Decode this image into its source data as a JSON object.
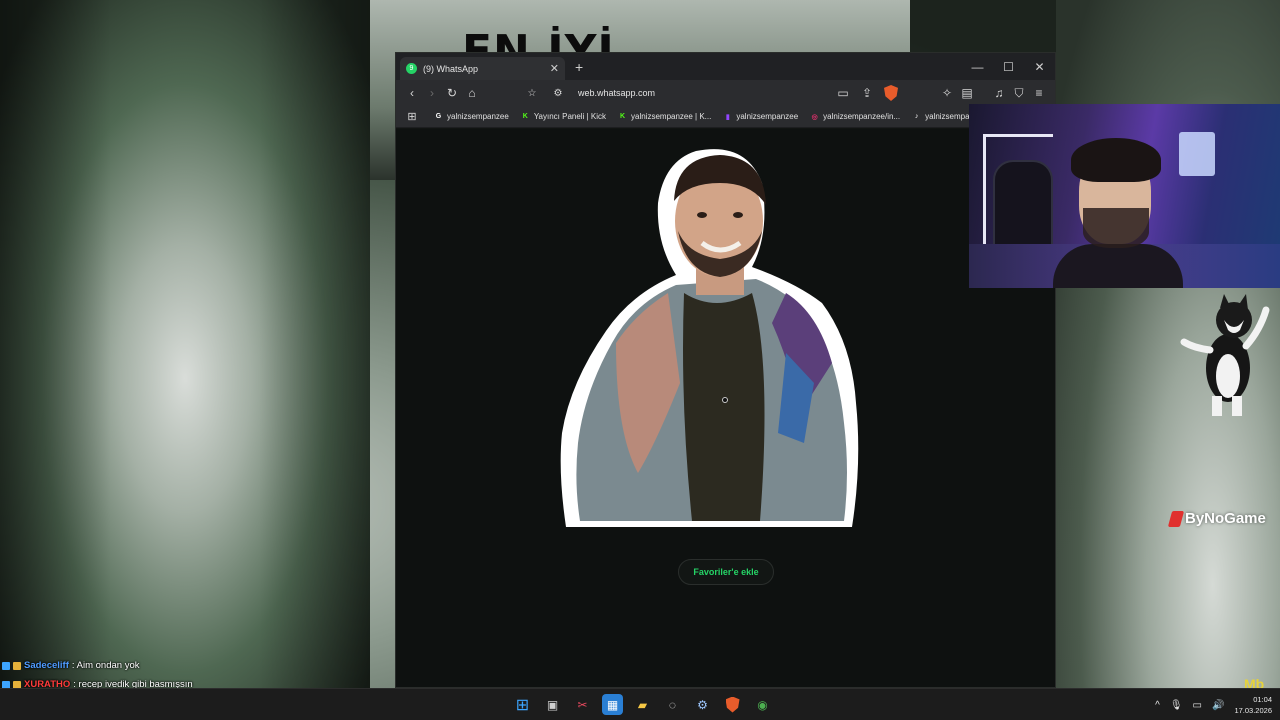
{
  "banner": {
    "text": "EN İYİ AVRUPA"
  },
  "browser": {
    "tab": {
      "favicon_label": "9",
      "title": "(9) WhatsApp",
      "close_icon": "close-icon"
    },
    "new_tab_icon": "plus-icon",
    "window_controls": {
      "minimize": "—",
      "maximize": "☐",
      "close": "✕"
    },
    "toolbar": {
      "back": "‹",
      "forward": "›",
      "reload": "↻",
      "home": "⌂",
      "bookmark": "🔖",
      "url": "web.whatsapp.com"
    },
    "bookmarks": [
      {
        "label": "yalnizsempanzee",
        "icon": "google-icon",
        "color": "#ffffff",
        "glyph": "G"
      },
      {
        "label": "Yayıncı Paneli | Kick",
        "icon": "kick-icon",
        "color": "#53fc18",
        "glyph": "K"
      },
      {
        "label": "yalnizsempanzee | K...",
        "icon": "kick-icon",
        "color": "#53fc18",
        "glyph": "K"
      },
      {
        "label": "yalnizsempanzee",
        "icon": "twitch-icon",
        "color": "#9146ff",
        "glyph": "▮"
      },
      {
        "label": "yalnizsempanzee/in...",
        "icon": "instagram-icon",
        "color": "#e1306c",
        "glyph": "◎"
      },
      {
        "label": "yalnizsempanze",
        "icon": "tiktok-icon",
        "color": "#ffffff",
        "glyph": "♪"
      }
    ],
    "page": {
      "favorite_button": "Favoriler'e ekle"
    }
  },
  "overlay": {
    "sponsor": "ByNoGame",
    "corner_logo": "Mb"
  },
  "chat": [
    {
      "user": "Sadeceliff",
      "message": ": Aim ondan yok",
      "color": "#4e9bff"
    },
    {
      "user": "XURATHO",
      "message": ": recep ivedik gibi basmışsın",
      "color": "#ff3b3b"
    }
  ],
  "taskbar": {
    "apps": [
      "windows-start-icon",
      "task-view-icon",
      "screenshot-tool-icon",
      "photos-icon",
      "file-explorer-icon",
      "obs-icon",
      "steam-icon",
      "brave-icon",
      "chrome-icon"
    ],
    "clock_time": "01:04",
    "clock_date": "17.03.2026"
  },
  "colors": {
    "whatsapp_green": "#25d366",
    "browser_bg": "#111412",
    "taskbar_bg": "#1c1c1c"
  }
}
